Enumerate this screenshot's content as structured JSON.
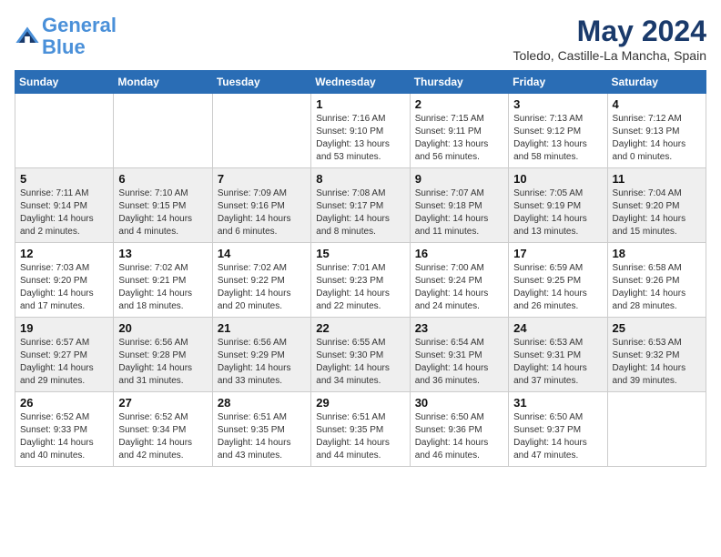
{
  "header": {
    "logo_line1": "General",
    "logo_line2": "Blue",
    "month": "May 2024",
    "location": "Toledo, Castille-La Mancha, Spain"
  },
  "weekdays": [
    "Sunday",
    "Monday",
    "Tuesday",
    "Wednesday",
    "Thursday",
    "Friday",
    "Saturday"
  ],
  "weeks": [
    [
      {
        "day": "",
        "info": ""
      },
      {
        "day": "",
        "info": ""
      },
      {
        "day": "",
        "info": ""
      },
      {
        "day": "1",
        "info": "Sunrise: 7:16 AM\nSunset: 9:10 PM\nDaylight: 13 hours and 53 minutes."
      },
      {
        "day": "2",
        "info": "Sunrise: 7:15 AM\nSunset: 9:11 PM\nDaylight: 13 hours and 56 minutes."
      },
      {
        "day": "3",
        "info": "Sunrise: 7:13 AM\nSunset: 9:12 PM\nDaylight: 13 hours and 58 minutes."
      },
      {
        "day": "4",
        "info": "Sunrise: 7:12 AM\nSunset: 9:13 PM\nDaylight: 14 hours and 0 minutes."
      }
    ],
    [
      {
        "day": "5",
        "info": "Sunrise: 7:11 AM\nSunset: 9:14 PM\nDaylight: 14 hours and 2 minutes."
      },
      {
        "day": "6",
        "info": "Sunrise: 7:10 AM\nSunset: 9:15 PM\nDaylight: 14 hours and 4 minutes."
      },
      {
        "day": "7",
        "info": "Sunrise: 7:09 AM\nSunset: 9:16 PM\nDaylight: 14 hours and 6 minutes."
      },
      {
        "day": "8",
        "info": "Sunrise: 7:08 AM\nSunset: 9:17 PM\nDaylight: 14 hours and 8 minutes."
      },
      {
        "day": "9",
        "info": "Sunrise: 7:07 AM\nSunset: 9:18 PM\nDaylight: 14 hours and 11 minutes."
      },
      {
        "day": "10",
        "info": "Sunrise: 7:05 AM\nSunset: 9:19 PM\nDaylight: 14 hours and 13 minutes."
      },
      {
        "day": "11",
        "info": "Sunrise: 7:04 AM\nSunset: 9:20 PM\nDaylight: 14 hours and 15 minutes."
      }
    ],
    [
      {
        "day": "12",
        "info": "Sunrise: 7:03 AM\nSunset: 9:20 PM\nDaylight: 14 hours and 17 minutes."
      },
      {
        "day": "13",
        "info": "Sunrise: 7:02 AM\nSunset: 9:21 PM\nDaylight: 14 hours and 18 minutes."
      },
      {
        "day": "14",
        "info": "Sunrise: 7:02 AM\nSunset: 9:22 PM\nDaylight: 14 hours and 20 minutes."
      },
      {
        "day": "15",
        "info": "Sunrise: 7:01 AM\nSunset: 9:23 PM\nDaylight: 14 hours and 22 minutes."
      },
      {
        "day": "16",
        "info": "Sunrise: 7:00 AM\nSunset: 9:24 PM\nDaylight: 14 hours and 24 minutes."
      },
      {
        "day": "17",
        "info": "Sunrise: 6:59 AM\nSunset: 9:25 PM\nDaylight: 14 hours and 26 minutes."
      },
      {
        "day": "18",
        "info": "Sunrise: 6:58 AM\nSunset: 9:26 PM\nDaylight: 14 hours and 28 minutes."
      }
    ],
    [
      {
        "day": "19",
        "info": "Sunrise: 6:57 AM\nSunset: 9:27 PM\nDaylight: 14 hours and 29 minutes."
      },
      {
        "day": "20",
        "info": "Sunrise: 6:56 AM\nSunset: 9:28 PM\nDaylight: 14 hours and 31 minutes."
      },
      {
        "day": "21",
        "info": "Sunrise: 6:56 AM\nSunset: 9:29 PM\nDaylight: 14 hours and 33 minutes."
      },
      {
        "day": "22",
        "info": "Sunrise: 6:55 AM\nSunset: 9:30 PM\nDaylight: 14 hours and 34 minutes."
      },
      {
        "day": "23",
        "info": "Sunrise: 6:54 AM\nSunset: 9:31 PM\nDaylight: 14 hours and 36 minutes."
      },
      {
        "day": "24",
        "info": "Sunrise: 6:53 AM\nSunset: 9:31 PM\nDaylight: 14 hours and 37 minutes."
      },
      {
        "day": "25",
        "info": "Sunrise: 6:53 AM\nSunset: 9:32 PM\nDaylight: 14 hours and 39 minutes."
      }
    ],
    [
      {
        "day": "26",
        "info": "Sunrise: 6:52 AM\nSunset: 9:33 PM\nDaylight: 14 hours and 40 minutes."
      },
      {
        "day": "27",
        "info": "Sunrise: 6:52 AM\nSunset: 9:34 PM\nDaylight: 14 hours and 42 minutes."
      },
      {
        "day": "28",
        "info": "Sunrise: 6:51 AM\nSunset: 9:35 PM\nDaylight: 14 hours and 43 minutes."
      },
      {
        "day": "29",
        "info": "Sunrise: 6:51 AM\nSunset: 9:35 PM\nDaylight: 14 hours and 44 minutes."
      },
      {
        "day": "30",
        "info": "Sunrise: 6:50 AM\nSunset: 9:36 PM\nDaylight: 14 hours and 46 minutes."
      },
      {
        "day": "31",
        "info": "Sunrise: 6:50 AM\nSunset: 9:37 PM\nDaylight: 14 hours and 47 minutes."
      },
      {
        "day": "",
        "info": ""
      }
    ]
  ]
}
